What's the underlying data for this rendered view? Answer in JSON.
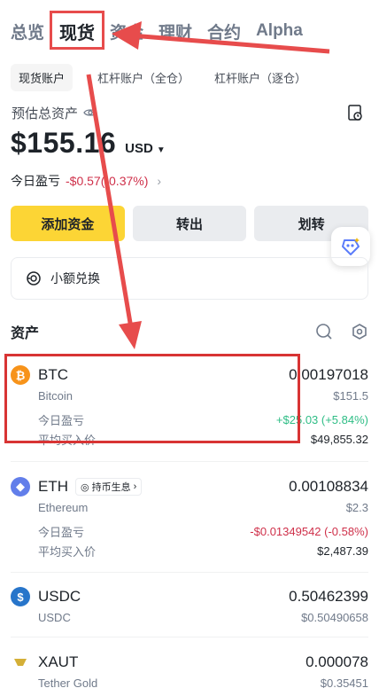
{
  "top_tabs": [
    "总览",
    "现货",
    "资金",
    "理财",
    "合约",
    "Alpha"
  ],
  "sub_tabs": [
    "现货账户",
    "杠杆账户（全仓）",
    "杠杆账户（逐仓）"
  ],
  "estimate": {
    "label": "预估总资产",
    "balance": "$155.16",
    "currency": "USD"
  },
  "pnl": {
    "label": "今日盈亏",
    "value": "-$0.57(-0.37%)"
  },
  "actions": {
    "deposit": "添加资金",
    "withdraw": "转出",
    "transfer": "划转"
  },
  "convert": {
    "label": "小额兑换"
  },
  "assets": {
    "title": "资产",
    "pnl_label": "今日盈亏",
    "avg_label": "平均买入价",
    "items": [
      {
        "symbol": "BTC",
        "name": "Bitcoin",
        "amount": "0.00197018",
        "value": "$151.5",
        "pnl": "+$25.03 (+5.84%)",
        "avg": "$49,855.32",
        "color": "#f7931a"
      },
      {
        "symbol": "ETH",
        "name": "Ethereum",
        "amount": "0.00108834",
        "value": "$2.3",
        "pnl": "-$0.01349542 (-0.58%)",
        "avg": "$2,487.39",
        "badge": "持币生息",
        "color": "#627eea"
      },
      {
        "symbol": "USDC",
        "name": "USDC",
        "amount": "0.50462399",
        "value": "$0.50490658",
        "color": "#2775ca"
      },
      {
        "symbol": "XAUT",
        "name": "Tether Gold",
        "amount": "0.000078",
        "value": "$0.35451",
        "color": "#d4af37"
      }
    ]
  },
  "colors": {
    "accent": "#fcd535",
    "negative": "#cf304a",
    "positive": "#2ebd85",
    "annotation": "#e74c4c"
  }
}
